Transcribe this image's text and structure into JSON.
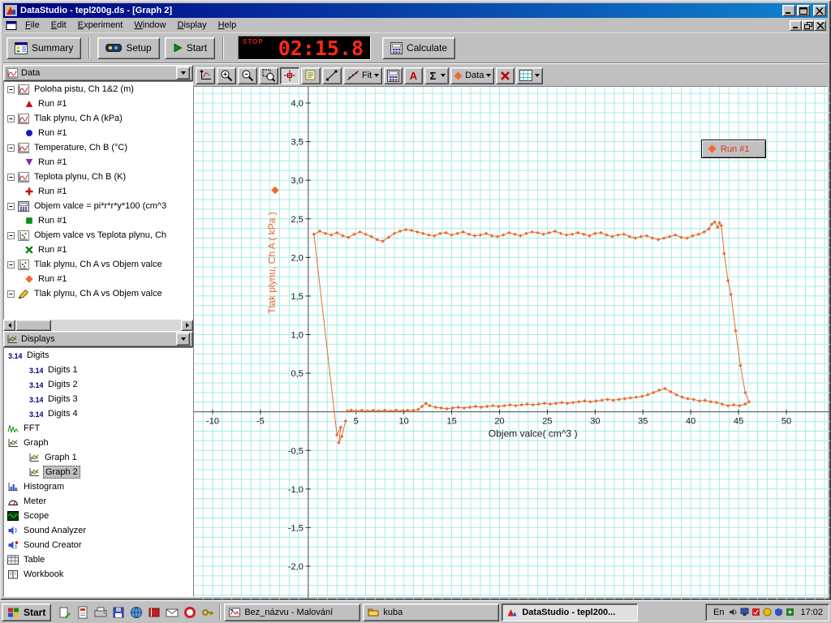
{
  "window": {
    "title": "DataStudio - tepl200g.ds - [Graph 2]"
  },
  "menu_bar": [
    "File",
    "Edit",
    "Experiment",
    "Window",
    "Display",
    "Help"
  ],
  "main_toolbar": {
    "summary": "Summary",
    "setup": "Setup",
    "start": "Start",
    "timer_mode": "STOP",
    "timer_value": "02:15.8",
    "calculate": "Calculate"
  },
  "graph_toolbar": [
    {
      "name": "scale-to-fit-button",
      "icon": "autoscale"
    },
    {
      "name": "zoom-in-button",
      "icon": "zoomin"
    },
    {
      "name": "zoom-out-button",
      "icon": "zoomout"
    },
    {
      "name": "zoom-select-button",
      "icon": "zoomsel"
    },
    {
      "name": "smart-tool-button",
      "icon": "smart",
      "active": true
    },
    {
      "name": "note-tool-button",
      "icon": "note"
    },
    {
      "name": "slope-tool-button",
      "icon": "slope"
    },
    {
      "name": "fit-menu-button",
      "icon": "fitline",
      "label": "Fit",
      "dropdown": true
    },
    {
      "name": "calculate-tool-button",
      "icon": "calcicon"
    },
    {
      "name": "text-tool-button",
      "icon": "textA"
    },
    {
      "name": "statistics-menu-button",
      "icon": "sigma",
      "dropdown": true
    },
    {
      "name": "data-menu-button",
      "icon": "datadiamond",
      "label": "Data",
      "dropdown": true
    },
    {
      "name": "remove-button",
      "icon": "redx"
    },
    {
      "name": "graph-settings-button",
      "icon": "gridicon",
      "dropdown": true
    }
  ],
  "data_panel": {
    "header": "Data",
    "items": [
      {
        "label": "Poloha pistu, Ch 1&2 (m)",
        "icon": "sensor",
        "runs": [
          {
            "label": "Run #1",
            "marker": "triangle-up",
            "color": "#cc1010"
          }
        ]
      },
      {
        "label": "Tlak plynu, Ch A (kPa)",
        "icon": "sensor",
        "runs": [
          {
            "label": "Run #1",
            "marker": "circle",
            "color": "#1020c0"
          }
        ]
      },
      {
        "label": "Temperature, Ch B (°C)",
        "icon": "sensor",
        "runs": [
          {
            "label": "Run #1",
            "marker": "triangle-down",
            "color": "#8820c0"
          }
        ]
      },
      {
        "label": "Teplota plynu, Ch B (K)",
        "icon": "sensor",
        "runs": [
          {
            "label": "Run #1",
            "marker": "plus",
            "color": "#cc1010"
          }
        ]
      },
      {
        "label": "Objem valce = pi*r*r*y*100 (cm^3",
        "icon": "calcdata",
        "runs": [
          {
            "label": "Run #1",
            "marker": "square",
            "color": "#0a9010"
          }
        ]
      },
      {
        "label": "Objem valce vs Teplota plynu, Ch",
        "icon": "xydata",
        "runs": [
          {
            "label": "Run #1",
            "marker": "x",
            "color": "#0a8010"
          }
        ]
      },
      {
        "label": "Tlak plynu, Ch A vs Objem valce",
        "icon": "xydata",
        "runs": [
          {
            "label": "Run #1",
            "marker": "diamond",
            "color": "#f0682a"
          }
        ]
      },
      {
        "label": "Tlak plynu, Ch A vs Objem valce",
        "icon": "pen",
        "runs": []
      }
    ]
  },
  "displays_panel": {
    "header": "Displays",
    "items": [
      {
        "label": "Digits",
        "icon": "digits",
        "children": [
          {
            "label": "Digits 1",
            "icon": "digits"
          },
          {
            "label": "Digits 2",
            "icon": "digits"
          },
          {
            "label": "Digits 3",
            "icon": "digits"
          },
          {
            "label": "Digits 4",
            "icon": "digits"
          }
        ]
      },
      {
        "label": "FFT",
        "icon": "fft"
      },
      {
        "label": "Graph",
        "icon": "graphdisp",
        "children": [
          {
            "label": "Graph 1",
            "icon": "graphdisp"
          },
          {
            "label": "Graph 2",
            "icon": "graphdisp",
            "selected": true
          }
        ]
      },
      {
        "label": "Histogram",
        "icon": "histogram"
      },
      {
        "label": "Meter",
        "icon": "meter"
      },
      {
        "label": "Scope",
        "icon": "scope"
      },
      {
        "label": "Sound Analyzer",
        "icon": "soundan"
      },
      {
        "label": "Sound Creator",
        "icon": "soundcr"
      },
      {
        "label": "Table",
        "icon": "tableicon"
      },
      {
        "label": "Workbook",
        "icon": "workbook"
      }
    ]
  },
  "chart_data": {
    "type": "scatter",
    "title": "",
    "xlabel": "Objem valce( cm^3 )",
    "ylabel": "Tlak plynu, Ch A ( kPa )",
    "xlim": [
      -12,
      55
    ],
    "ylim": [
      -2.35,
      4.25
    ],
    "grid": true,
    "x_ticks": [
      -10,
      -5,
      5,
      10,
      15,
      20,
      25,
      30,
      35,
      40,
      45,
      50
    ],
    "x_tick_labels": [
      "-10",
      "-5",
      "5",
      "10",
      "15",
      "20",
      "25",
      "30",
      "35",
      "40",
      "45",
      "50"
    ],
    "y_ticks": [
      -2.0,
      -1.5,
      -1.0,
      -0.5,
      0.5,
      1.0,
      1.5,
      2.0,
      2.5,
      3.0,
      3.5,
      4.0
    ],
    "y_tick_labels": [
      "-2,0",
      "-1,5",
      "-1,0",
      "-0,5",
      "0,5",
      "1,0",
      "1,5",
      "2,0",
      "2,5",
      "3,0",
      "3,5",
      "4,0"
    ],
    "legend": {
      "label": "Run #1",
      "position": "top-right"
    },
    "series": [
      {
        "name": "Run #1",
        "marker": "diamond",
        "color": "#f0682a",
        "points": [
          [
            3.9,
            -0.12
          ],
          [
            3.5,
            -0.32
          ],
          [
            3.2,
            -0.4
          ],
          [
            3.4,
            -0.2
          ],
          [
            3.0,
            -0.3
          ],
          [
            0.6,
            2.3
          ],
          [
            1.2,
            2.34
          ],
          [
            1.8,
            2.31
          ],
          [
            2.4,
            2.29
          ],
          [
            3.0,
            2.32
          ],
          [
            3.6,
            2.28
          ],
          [
            4.2,
            2.26
          ],
          [
            4.8,
            2.3
          ],
          [
            5.4,
            2.33
          ],
          [
            6.0,
            2.3
          ],
          [
            6.6,
            2.27
          ],
          [
            7.2,
            2.23
          ],
          [
            7.8,
            2.21
          ],
          [
            8.4,
            2.26
          ],
          [
            9.0,
            2.31
          ],
          [
            9.6,
            2.34
          ],
          [
            10.2,
            2.36
          ],
          [
            10.8,
            2.35
          ],
          [
            11.4,
            2.33
          ],
          [
            12.0,
            2.31
          ],
          [
            12.6,
            2.29
          ],
          [
            13.2,
            2.28
          ],
          [
            13.8,
            2.31
          ],
          [
            14.4,
            2.32
          ],
          [
            15.0,
            2.29
          ],
          [
            15.6,
            2.31
          ],
          [
            16.2,
            2.33
          ],
          [
            16.8,
            2.3
          ],
          [
            17.4,
            2.28
          ],
          [
            18.0,
            2.29
          ],
          [
            18.6,
            2.31
          ],
          [
            19.2,
            2.28
          ],
          [
            19.8,
            2.27
          ],
          [
            20.4,
            2.29
          ],
          [
            21.0,
            2.32
          ],
          [
            21.6,
            2.3
          ],
          [
            22.2,
            2.28
          ],
          [
            22.8,
            2.31
          ],
          [
            23.4,
            2.33
          ],
          [
            24.0,
            2.32
          ],
          [
            24.6,
            2.3
          ],
          [
            25.2,
            2.32
          ],
          [
            25.8,
            2.34
          ],
          [
            26.4,
            2.31
          ],
          [
            27.0,
            2.29
          ],
          [
            27.6,
            2.3
          ],
          [
            28.2,
            2.32
          ],
          [
            28.8,
            2.3
          ],
          [
            29.4,
            2.28
          ],
          [
            30.0,
            2.31
          ],
          [
            30.6,
            2.32
          ],
          [
            31.2,
            2.29
          ],
          [
            31.8,
            2.27
          ],
          [
            32.4,
            2.29
          ],
          [
            33.0,
            2.3
          ],
          [
            33.6,
            2.27
          ],
          [
            34.2,
            2.25
          ],
          [
            34.8,
            2.27
          ],
          [
            35.4,
            2.28
          ],
          [
            36.0,
            2.25
          ],
          [
            36.6,
            2.23
          ],
          [
            37.2,
            2.25
          ],
          [
            37.8,
            2.27
          ],
          [
            38.4,
            2.29
          ],
          [
            39.0,
            2.26
          ],
          [
            39.6,
            2.25
          ],
          [
            40.2,
            2.28
          ],
          [
            40.8,
            2.3
          ],
          [
            41.4,
            2.33
          ],
          [
            41.9,
            2.37
          ],
          [
            42.2,
            2.43
          ],
          [
            42.5,
            2.46
          ],
          [
            42.8,
            2.39
          ],
          [
            43.0,
            2.45
          ],
          [
            43.2,
            2.41
          ],
          [
            43.5,
            2.05
          ],
          [
            43.9,
            1.7
          ],
          [
            44.2,
            1.52
          ],
          [
            44.7,
            1.05
          ],
          [
            45.2,
            0.6
          ],
          [
            45.7,
            0.25
          ],
          [
            46.1,
            0.13
          ],
          [
            45.7,
            0.1
          ],
          [
            45.1,
            0.08
          ],
          [
            44.5,
            0.09
          ],
          [
            43.9,
            0.08
          ],
          [
            43.3,
            0.1
          ],
          [
            42.7,
            0.12
          ],
          [
            42.1,
            0.13
          ],
          [
            41.5,
            0.15
          ],
          [
            40.9,
            0.14
          ],
          [
            40.3,
            0.16
          ],
          [
            39.7,
            0.17
          ],
          [
            39.1,
            0.19
          ],
          [
            38.5,
            0.22
          ],
          [
            37.9,
            0.26
          ],
          [
            37.3,
            0.3
          ],
          [
            36.7,
            0.28
          ],
          [
            36.1,
            0.25
          ],
          [
            35.5,
            0.22
          ],
          [
            34.9,
            0.2
          ],
          [
            34.3,
            0.19
          ],
          [
            33.7,
            0.18
          ],
          [
            33.1,
            0.17
          ],
          [
            32.5,
            0.16
          ],
          [
            31.9,
            0.15
          ],
          [
            31.3,
            0.16
          ],
          [
            30.7,
            0.15
          ],
          [
            30.1,
            0.14
          ],
          [
            29.5,
            0.13
          ],
          [
            28.9,
            0.14
          ],
          [
            28.3,
            0.13
          ],
          [
            27.7,
            0.12
          ],
          [
            27.1,
            0.11
          ],
          [
            26.5,
            0.12
          ],
          [
            25.9,
            0.11
          ],
          [
            25.3,
            0.1
          ],
          [
            24.7,
            0.11
          ],
          [
            24.1,
            0.1
          ],
          [
            23.5,
            0.09
          ],
          [
            22.9,
            0.1
          ],
          [
            22.3,
            0.09
          ],
          [
            21.7,
            0.08
          ],
          [
            21.1,
            0.09
          ],
          [
            20.5,
            0.08
          ],
          [
            19.9,
            0.07
          ],
          [
            19.3,
            0.08
          ],
          [
            18.7,
            0.07
          ],
          [
            18.1,
            0.06
          ],
          [
            17.5,
            0.07
          ],
          [
            16.9,
            0.06
          ],
          [
            16.3,
            0.05
          ],
          [
            15.7,
            0.06
          ],
          [
            15.1,
            0.05
          ],
          [
            14.5,
            0.04
          ],
          [
            13.9,
            0.05
          ],
          [
            13.3,
            0.06
          ],
          [
            12.7,
            0.08
          ],
          [
            12.3,
            0.11
          ],
          [
            11.9,
            0.07
          ],
          [
            11.5,
            0.03
          ],
          [
            11.0,
            0.02
          ],
          [
            10.4,
            0.02
          ],
          [
            9.8,
            0.01
          ],
          [
            9.2,
            0.02
          ],
          [
            8.6,
            0.01
          ],
          [
            8.0,
            0.02
          ],
          [
            7.4,
            0.01
          ],
          [
            6.8,
            0.02
          ],
          [
            6.2,
            0.01
          ],
          [
            5.6,
            0.02
          ],
          [
            5.0,
            0.01
          ],
          [
            4.5,
            0.02
          ],
          [
            4.1,
            0.01
          ]
        ]
      }
    ]
  },
  "taskbar": {
    "start": "Start",
    "quick_launch": [
      {
        "name": "quicklaunch-shortcut-1",
        "icon": "q1"
      },
      {
        "name": "quicklaunch-shortcut-2",
        "icon": "q2"
      },
      {
        "name": "quicklaunch-shortcut-3",
        "icon": "q3"
      },
      {
        "name": "quicklaunch-shortcut-4",
        "icon": "q4"
      },
      {
        "name": "quicklaunch-shortcut-5",
        "icon": "q5"
      },
      {
        "name": "quicklaunch-shortcut-6",
        "icon": "q6"
      },
      {
        "name": "quicklaunch-shortcut-7",
        "icon": "q7"
      },
      {
        "name": "quicklaunch-shortcut-8",
        "icon": "q8"
      },
      {
        "name": "quicklaunch-shortcut-9",
        "icon": "q9"
      }
    ],
    "tasks": [
      {
        "label": "Bez_názvu - Malování",
        "icon": "paint",
        "active": false
      },
      {
        "label": "kuba",
        "icon": "folder",
        "active": false
      },
      {
        "label": "DataStudio - tepl200...",
        "icon": "dsicon",
        "active": true
      }
    ],
    "language": "En",
    "tray_icons": [
      {
        "name": "tray-icon-1",
        "icon": "t1"
      },
      {
        "name": "tray-icon-2",
        "icon": "t2"
      },
      {
        "name": "tray-icon-3",
        "icon": "t3"
      },
      {
        "name": "tray-icon-4",
        "icon": "t4"
      },
      {
        "name": "tray-icon-5",
        "icon": "t5"
      },
      {
        "name": "tray-icon-6",
        "icon": "t6"
      }
    ],
    "time": "17:02"
  }
}
